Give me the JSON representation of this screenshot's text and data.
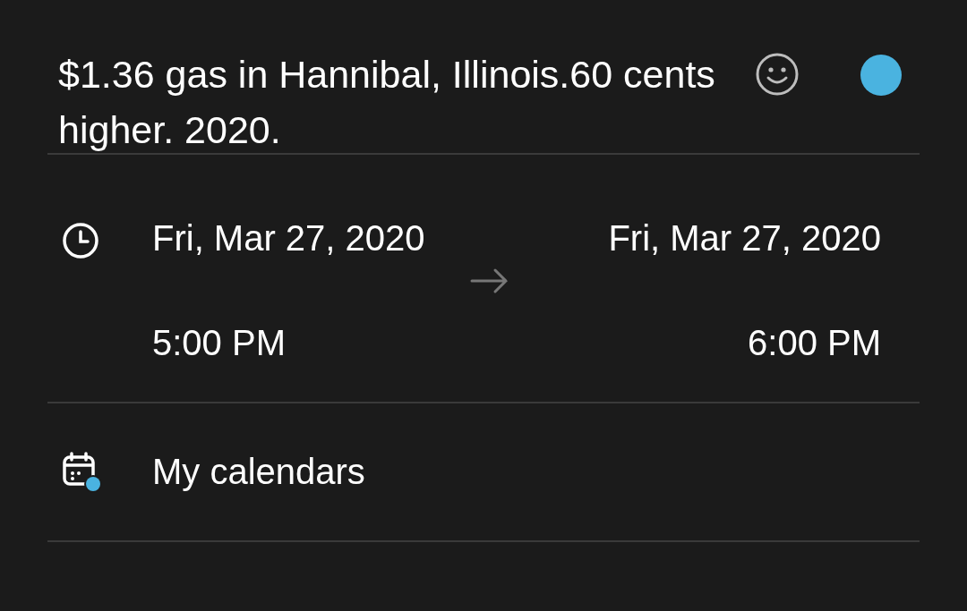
{
  "event": {
    "title": "$1.36 gas in Hannibal, Illinois.60 cents higher. 2020.",
    "color": "#4ab3e0"
  },
  "time": {
    "start_date": "Fri, Mar 27, 2020",
    "start_time": "5:00 PM",
    "end_date": "Fri, Mar 27, 2020",
    "end_time": "6:00 PM"
  },
  "calendar": {
    "label": "My calendars",
    "color": "#4ab3e0"
  }
}
